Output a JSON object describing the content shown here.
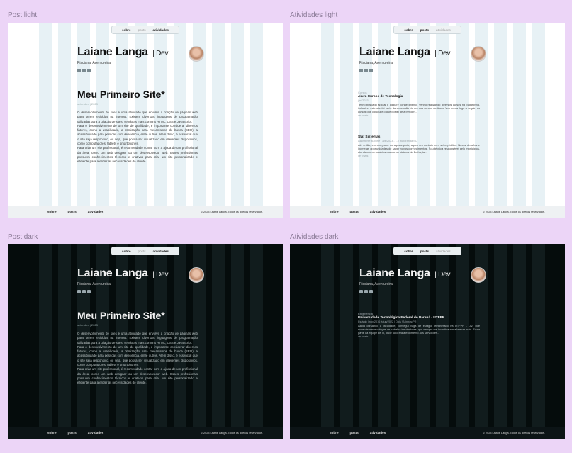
{
  "frames": {
    "post_light": {
      "label": "Post light"
    },
    "atividades_light": {
      "label": "Atividades light"
    },
    "post_dark": {
      "label": "Post dark"
    },
    "atividades_dark": {
      "label": "Atividades dark"
    }
  },
  "nav": {
    "sobre": "sobre",
    "posts": "posts",
    "atividades": "atividades"
  },
  "profile": {
    "name": "Laiane Langa",
    "role": "Dev",
    "tagline": "Pisciana, Aventureira,"
  },
  "post": {
    "title": "Meu Primeiro Site*",
    "date": "setembro | 2023",
    "paragraphs": [
      "O desenvolvimento de sites é uma atividade que envolve a criação de páginas web para serem exibidas na internet. Existem diversas linguagens de programação utilizadas para a criação de sites, sendo as mais comuns HTML, CSS e JavaScript.",
      "Para o desenvolvimento de um site de qualidade, é importante considerar diversos fatores, como a usabilidade, a otimização para mecanismos de busca (SEO), a acessibilidade para pessoas com deficiência, entre outros. Além disso, é essencial que o site seja responsivo, ou seja, que possa ser visualizado em diferentes dispositivos, como computadores, tablets e smartphones.",
      "Para criar um site profissional, é recomendado contar com a ajuda de um profissional da área, como um web designer ou um desenvolvedor web. Esses profissionais possuem conhecimentos técnicos e criativos para criar um site personalizado e eficiente para atender às necessidades do cliente."
    ]
  },
  "activities_light": [
    {
      "category": "Cursos",
      "title": "Alura Cursos de Tecnologia",
      "meta": "jan/2023 - ...",
      "description": "Tenho buscado aplicar e adquirir conhecimento. Venho realizando diversos cursos na plataforma, inclusive, este site foi parte da conclusão de um dos cursos da Alura. Vou deixar logo a seguir, os cursos que conclui e o que gostei de aprender...",
      "more": "ver mais"
    },
    {
      "category": "",
      "title": "Staf Sistemas",
      "meta": "Assistente suporte | abr/2023 - ... | Ituporanga/SC",
      "description": "Até então, em um grupo do agronegócio, agora em contato com setor público. Novos desafios e inúmeras oportunidades de saber novos conhecimentos. Sou técnica responsável pelo municípios, atendendo os usuários quanto ao sistema da Betha, ta...",
      "more": "ver mais"
    }
  ],
  "activities_dark": [
    {
      "category": "Experiência",
      "title": "Universidade Tecnológica Federal do Paraná - UTFPR",
      "meta": "Estágio | nov/2016 à jun/2022 | Dois Vizinhos/PR",
      "description": "Ainda cursando a faculdade, consegui vaga de estágio remunerado na UTFPR - DV. Tive supervisores e colegas de trabalho inspiradores, que sempre me incentivaram a buscar mais. Fazia parte da equipe de TI, onde tudo era atendimento aos servidores...",
      "more": "ver mais"
    }
  ],
  "footer": {
    "sobre": "sobre",
    "posts": "posts",
    "atividades": "atividades",
    "copyright": "© 2023 Laiane Langa. Todos os direitos reservados."
  }
}
